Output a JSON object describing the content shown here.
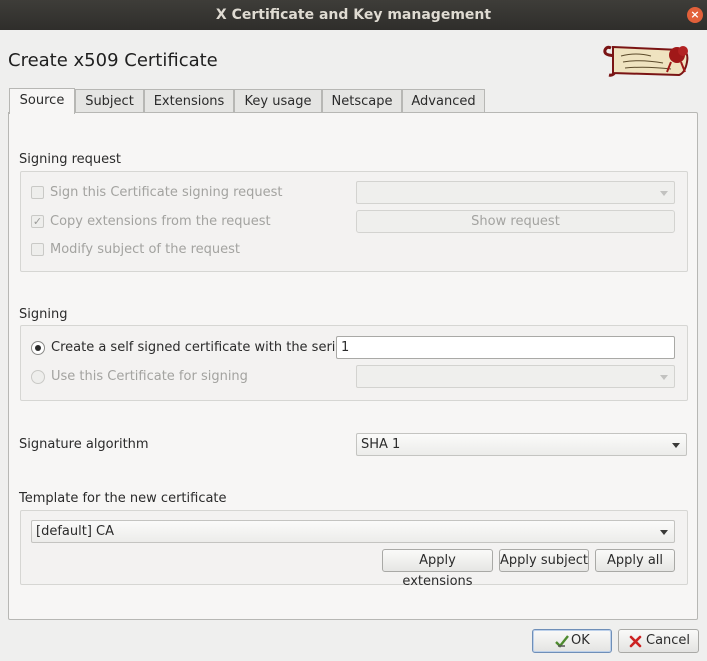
{
  "window": {
    "title": "X Certificate and Key management",
    "close_glyph": "×"
  },
  "dialog": {
    "title": "Create x509 Certificate"
  },
  "tabs": [
    {
      "label": "Source"
    },
    {
      "label": "Subject"
    },
    {
      "label": "Extensions"
    },
    {
      "label": "Key usage"
    },
    {
      "label": "Netscape"
    },
    {
      "label": "Advanced"
    }
  ],
  "signing_request": {
    "title": "Signing request",
    "sign_csr_label": "Sign this Certificate signing request",
    "sign_csr_checked": false,
    "copy_ext_label": "Copy extensions from the request",
    "copy_ext_checked": true,
    "modify_subject_label": "Modify subject of the request",
    "modify_subject_checked": false,
    "request_select_value": "",
    "show_request_label": "Show request"
  },
  "signing": {
    "title": "Signing",
    "self_signed_label": "Create a self signed certificate with the serial",
    "self_signed_selected": true,
    "serial_value": "1",
    "use_cert_label": "Use this Certificate for signing",
    "use_cert_selected": false,
    "ca_select_value": ""
  },
  "signature_algorithm": {
    "label": "Signature algorithm",
    "value": "SHA 1"
  },
  "template": {
    "title": "Template for the new certificate",
    "value": "[default] CA",
    "apply_extensions_label": "Apply extensions",
    "apply_subject_label": "Apply subject",
    "apply_all_label": "Apply all"
  },
  "footer": {
    "ok_label": "OK",
    "cancel_label": "Cancel",
    "ok_icon": "ok-check-icon",
    "cancel_icon": "cancel-x-icon"
  },
  "colors": {
    "titlebar": "#3e3d39",
    "close": "#e2603a",
    "cancel_icon": "#cc2222",
    "ok_icon": "#4e8b2f"
  }
}
